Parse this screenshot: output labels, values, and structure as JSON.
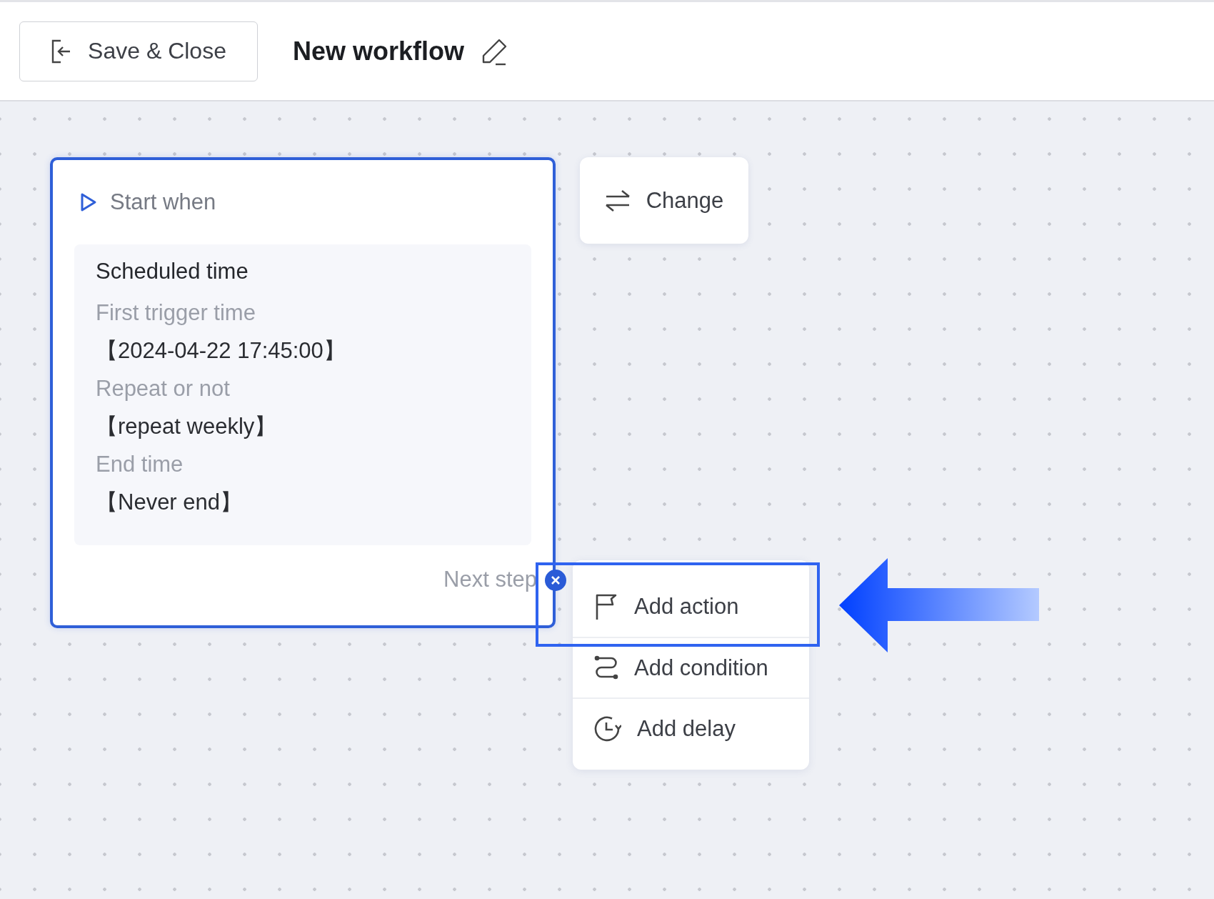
{
  "header": {
    "save_button": "Save & Close",
    "title": "New workflow"
  },
  "trigger": {
    "heading": "Start when",
    "title": "Scheduled time",
    "fields": [
      {
        "label": "First trigger time",
        "value": "【2024-04-22 17:45:00】"
      },
      {
        "label": "Repeat or not",
        "value": "【repeat weekly】"
      },
      {
        "label": "End time",
        "value": "【Never end】"
      }
    ],
    "next_step": "Next step"
  },
  "change_button": "Change",
  "menu": [
    {
      "label": "Add action",
      "kind": "action",
      "highlighted": true
    },
    {
      "label": "Add condition",
      "kind": "condition",
      "highlighted": false
    },
    {
      "label": "Add delay",
      "kind": "delay",
      "highlighted": false
    }
  ]
}
